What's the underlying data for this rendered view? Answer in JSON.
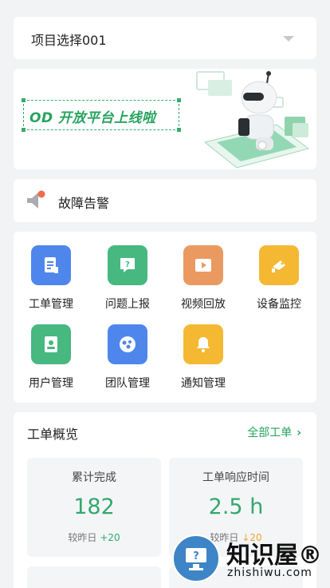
{
  "project_select": {
    "label": "项目选择001"
  },
  "banner": {
    "text": "OD 开放平台上线啦"
  },
  "alarm": {
    "label": "故障告警"
  },
  "grid": {
    "items": [
      {
        "label": "工单管理",
        "icon": "work-order-icon",
        "color": "#4f86ec"
      },
      {
        "label": "问题上报",
        "icon": "question-report-icon",
        "color": "#46b880"
      },
      {
        "label": "视频回放",
        "icon": "video-playback-icon",
        "color": "#ea9a61"
      },
      {
        "label": "设备监控",
        "icon": "device-monitor-icon",
        "color": "#f5b833"
      },
      {
        "label": "用户管理",
        "icon": "user-manage-icon",
        "color": "#46b880"
      },
      {
        "label": "团队管理",
        "icon": "team-manage-icon",
        "color": "#4f86ec"
      },
      {
        "label": "通知管理",
        "icon": "notification-icon",
        "color": "#f5b833"
      }
    ]
  },
  "overview": {
    "title": "工单概览",
    "all_link": "全部工单",
    "stats": [
      {
        "name": "累计完成",
        "value": "182",
        "compare_label": "较昨日",
        "delta": "+20",
        "delta_color": "#33a86c"
      },
      {
        "name": "工单响应时间",
        "value": "2.5 h",
        "compare_label": "较昨日",
        "delta": "↓20",
        "delta_color": "#f0a33a"
      }
    ]
  },
  "watermark": {
    "brand": "知识屋®",
    "domain": "zhishiwu.com"
  },
  "colors": {
    "accent": "#25a35c",
    "background": "#f2f3f5"
  }
}
